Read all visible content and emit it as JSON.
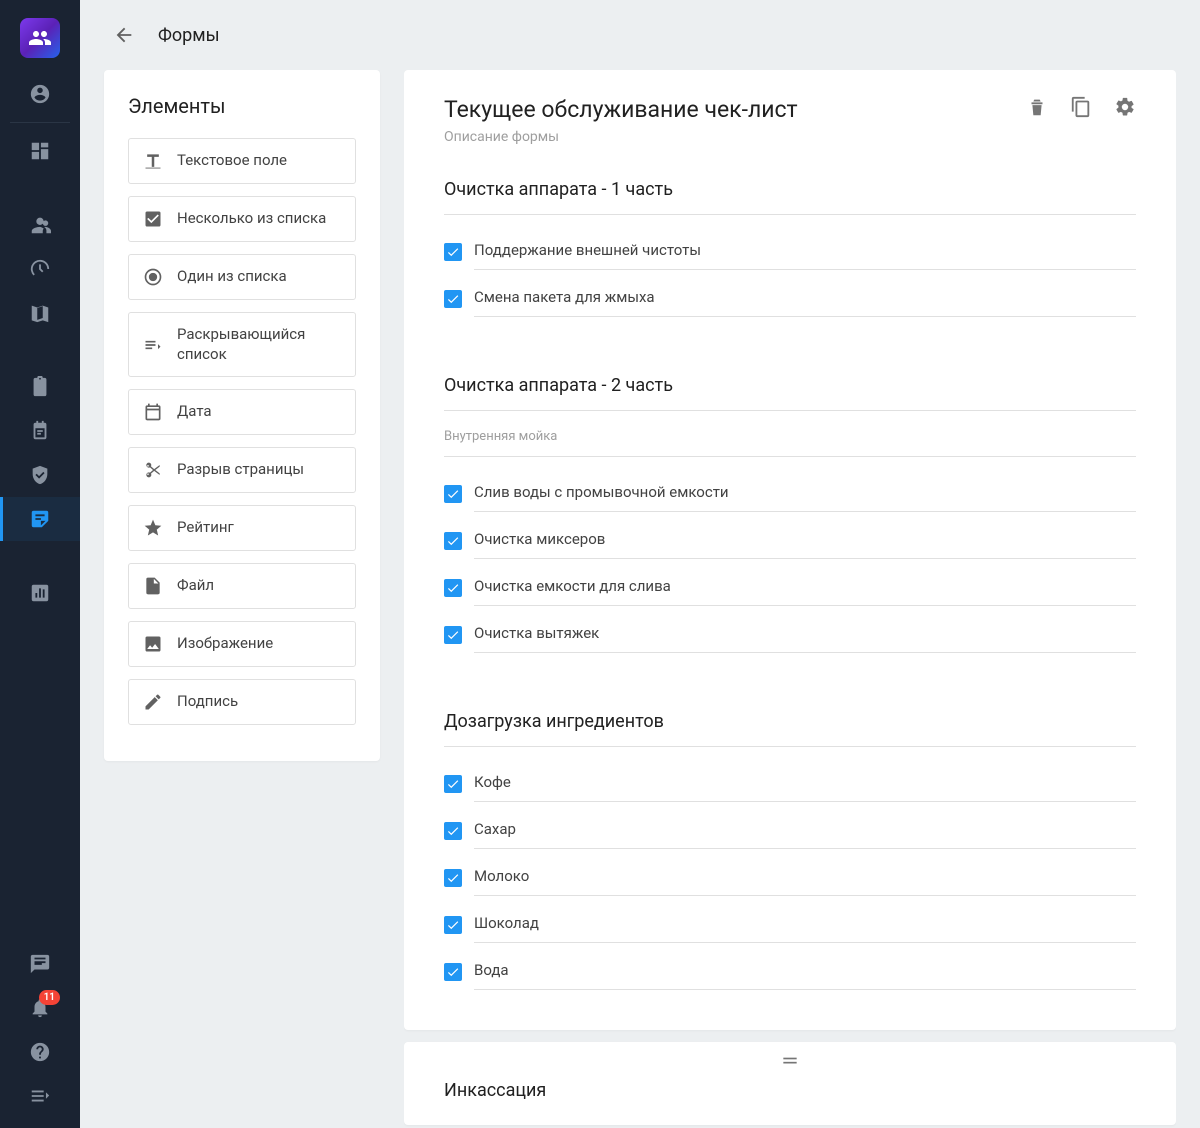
{
  "header": {
    "title": "Формы"
  },
  "nav": {
    "badge": "11"
  },
  "palette": {
    "title": "Элементы",
    "items": [
      {
        "label": "Текстовое поле"
      },
      {
        "label": "Несколько из списка"
      },
      {
        "label": "Один из списка"
      },
      {
        "label": "Раскрывающийся список"
      },
      {
        "label": "Дата"
      },
      {
        "label": "Разрыв страницы"
      },
      {
        "label": "Рейтинг"
      },
      {
        "label": "Файл"
      },
      {
        "label": "Изображение"
      },
      {
        "label": "Подпись"
      }
    ]
  },
  "form": {
    "title": "Текущее обслуживание чек-лист",
    "description": "Описание формы",
    "sections": [
      {
        "title": "Очистка аппарата - 1 часть",
        "items": [
          "Поддержание внешней чистоты",
          "Смена пакета для жмыха"
        ]
      },
      {
        "title": "Очистка аппарата - 2 часть",
        "subhead": "Внутренняя мойка",
        "items": [
          "Слив воды с промывочной емкости",
          "Очистка миксеров",
          "Очистка емкости для слива",
          "Очистка вытяжек"
        ]
      },
      {
        "title": "Дозагрузка ингредиентов",
        "items": [
          "Кофе",
          "Сахар",
          "Молоко",
          "Шоколад",
          "Вода"
        ]
      }
    ],
    "next_section_title": "Инкассация"
  }
}
